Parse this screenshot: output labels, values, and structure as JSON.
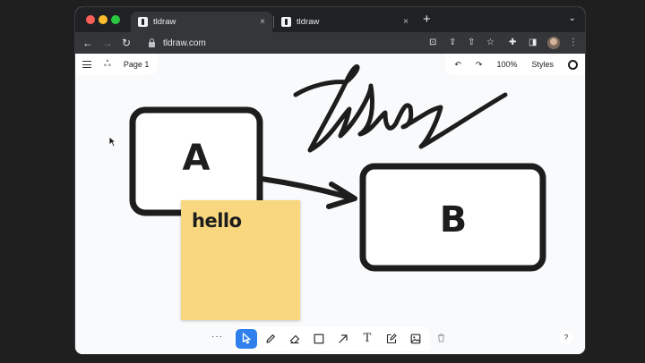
{
  "browser": {
    "tabs": [
      {
        "title": "tldraw",
        "close": "×"
      },
      {
        "title": "tldraw",
        "close": "×"
      }
    ],
    "new_tab": "+",
    "tab_list": "⌄",
    "url": "tldraw.com",
    "nav": {
      "back": "←",
      "forward": "→",
      "reload": "↻"
    },
    "toolbar_icons": {
      "install": "⊡",
      "share": "⇪",
      "upload": "⇧",
      "star": "☆",
      "extensions": "✚",
      "sidepanel": "◨",
      "menu": "⋮"
    }
  },
  "app": {
    "menu_panel": {
      "page_label": "Page 1",
      "people": "ஃ"
    },
    "style_panel": {
      "undo": "↶",
      "redo": "↷",
      "zoom": "100%",
      "styles_label": "Styles"
    },
    "canvas": {
      "shape_a_label": "A",
      "shape_b_label": "B",
      "sticky_text": "hello",
      "sticky_color": "#f9d77e"
    },
    "toolbar": {
      "more": "···",
      "tools": [
        "select",
        "draw",
        "eraser",
        "rectangle",
        "arrow",
        "text",
        "note",
        "image"
      ],
      "selected": "select",
      "text_tool_glyph": "T",
      "accent": "#2f80ed"
    },
    "help": "?"
  }
}
